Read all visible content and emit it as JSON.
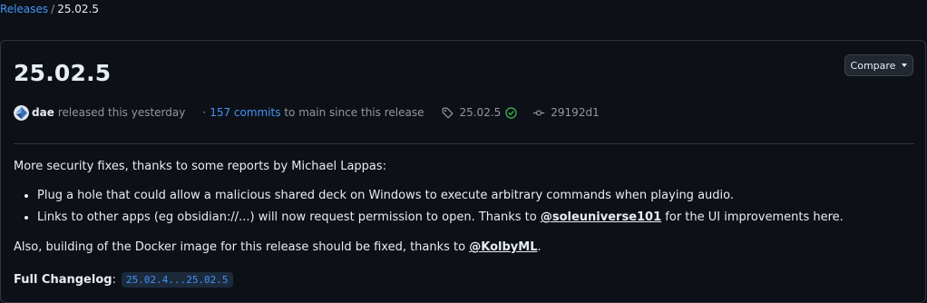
{
  "breadcrumb": {
    "releases_label": "Releases",
    "separator": "/",
    "current": "25.02.5"
  },
  "release": {
    "title": "25.02.5",
    "compare_label": "Compare",
    "author": "dae",
    "released_text": "released this yesterday",
    "dot": "·",
    "commits_label": "157 commits",
    "commits_suffix": "to main since this release",
    "tag": "25.02.5",
    "commit_hash": "29192d1"
  },
  "notes": {
    "intro": "More security fixes, thanks to some reports by Michael Lappas:",
    "bullet1": "Plug a hole that could allow a malicious shared deck on Windows to execute arbitrary commands when playing audio.",
    "bullet2_prefix": "Links to other apps (eg obsidian://...) will now request permission to open. Thanks to ",
    "bullet2_mention": "@soleuniverse101",
    "bullet2_suffix": " for the UI improvements here.",
    "also_prefix": "Also, building of the Docker image for this release should be fixed, thanks to ",
    "also_mention": "@KolbyML",
    "also_suffix": ".",
    "changelog_label": "Full Changelog",
    "changelog_colon": ":",
    "changelog_link": "25.02.4...25.02.5"
  },
  "colors": {
    "background": "#0d1117",
    "link": "#4493f8",
    "success": "#3fb950",
    "muted": "#9198a1",
    "border": "#30363d"
  },
  "icons": [
    "avatar",
    "tag-icon",
    "verified-check-icon",
    "commit-icon",
    "chevron-down-icon"
  ]
}
